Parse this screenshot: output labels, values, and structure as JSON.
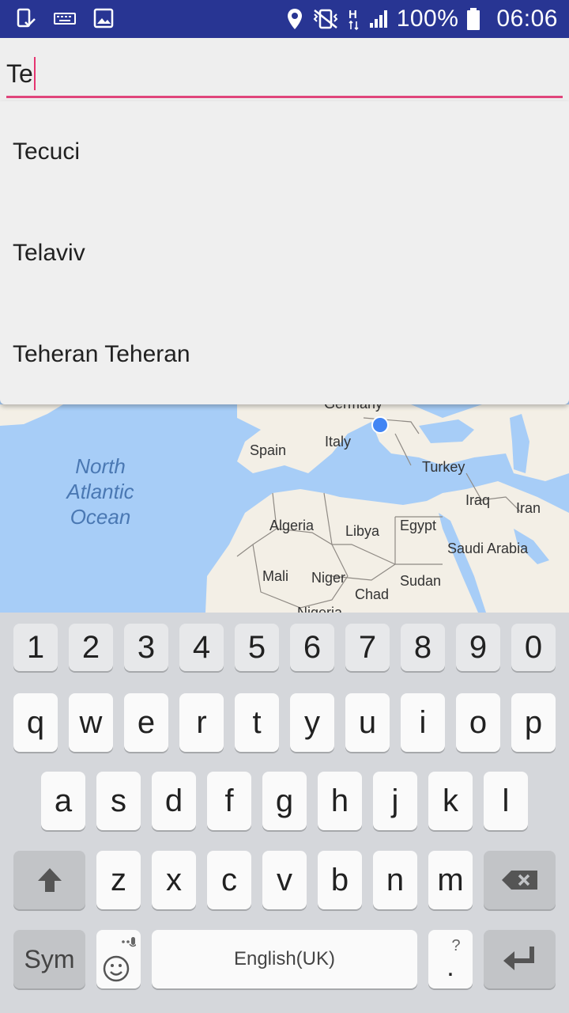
{
  "status_bar": {
    "battery": "100%",
    "time": "06:06",
    "network_letter": "H",
    "icons": [
      "screenshot-icon",
      "keyboard-icon",
      "image-icon",
      "location-icon",
      "vibrate-icon",
      "network-h-icon",
      "signal-icon",
      "battery-icon"
    ]
  },
  "search": {
    "value": "Te"
  },
  "suggestions": [
    "Tecuci",
    "Telaviv",
    "Teheran Teheran"
  ],
  "map": {
    "labels": {
      "germany": "Germany",
      "spain": "Spain",
      "italy": "Italy",
      "turkey": "Turkey",
      "iraq": "Iraq",
      "iran": "Iran",
      "algeria": "Algeria",
      "libya": "Libya",
      "egypt": "Egypt",
      "saudi": "Saudi Arabia",
      "mali": "Mali",
      "niger": "Niger",
      "sudan": "Sudan",
      "chad": "Chad",
      "nigeria": "Nigeria",
      "ocean1": "North",
      "ocean2": "Atlantic",
      "ocean3": "Ocean"
    }
  },
  "keyboard": {
    "row_numbers": [
      "1",
      "2",
      "3",
      "4",
      "5",
      "6",
      "7",
      "8",
      "9",
      "0"
    ],
    "row_top": [
      "q",
      "w",
      "e",
      "r",
      "t",
      "y",
      "u",
      "i",
      "o",
      "p"
    ],
    "row_mid": [
      "a",
      "s",
      "d",
      "f",
      "g",
      "h",
      "j",
      "k",
      "l"
    ],
    "row_bottom": [
      "z",
      "x",
      "c",
      "v",
      "b",
      "n",
      "m"
    ],
    "sym_label": "Sym",
    "space_label": "English(UK)",
    "period_label": ".",
    "period_hint": "?",
    "colors": {
      "accent": "#e0457b",
      "status_bar": "#283593",
      "map_water": "#a7cdf7",
      "my_location": "#4285f4"
    }
  }
}
